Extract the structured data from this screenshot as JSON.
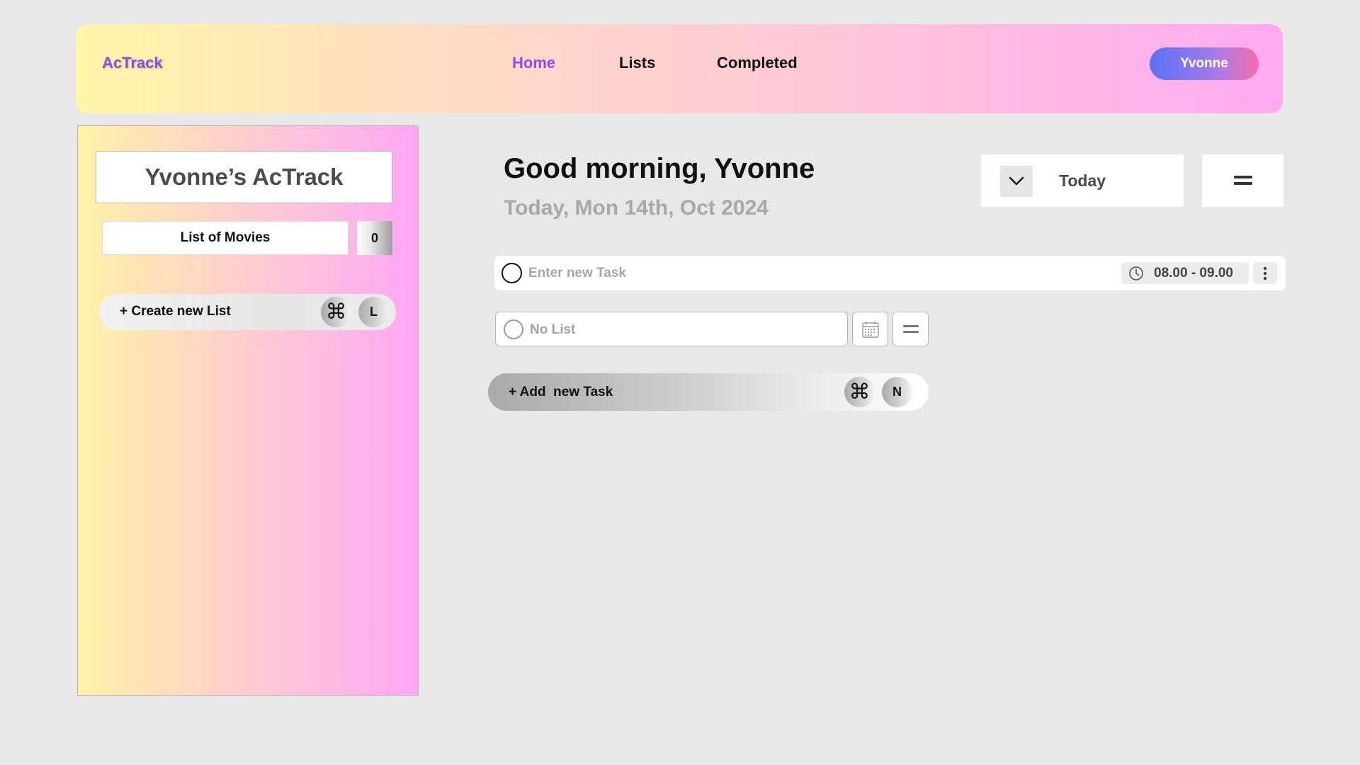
{
  "app": {
    "logo": "AcTrack"
  },
  "nav": {
    "items": [
      {
        "label": "Home",
        "active": true
      },
      {
        "label": "Lists",
        "active": false
      },
      {
        "label": "Completed",
        "active": false
      }
    ],
    "user": "Yvonne"
  },
  "sidebar": {
    "title": "Yvonne’s AcTrack",
    "lists": [
      {
        "name": "List of Movies",
        "count": "0"
      }
    ],
    "create_label": "+ Create new List",
    "create_shortcut": {
      "modifier": "⌘",
      "key": "L"
    }
  },
  "main": {
    "greeting": "Good morning, Yvonne",
    "date": "Today, Mon 14th, Oct 2024",
    "filter": {
      "label": "Today"
    },
    "task_entry": {
      "placeholder": "Enter new Task",
      "time": "08.00 - 09.00"
    },
    "list_select": {
      "label": "No List"
    },
    "add_task": {
      "label": "+ Add  new Task",
      "shortcut": {
        "modifier": "⌘",
        "key": "N"
      }
    }
  },
  "colors": {
    "accent": "#8a4cf0",
    "user_pill_start": "#5a72f6",
    "user_pill_end": "#f36fad",
    "header_gradient_start": "#fff6a8",
    "header_gradient_end": "#ffaaf3"
  },
  "icons": {
    "filter_toggle": "chevron-down-icon",
    "menu": "equals-icon",
    "time": "clock-icon",
    "more": "vertical-dots-icon",
    "calendar": "calendar-icon",
    "priority": "equals-icon",
    "shortcut_modifier": "command-key-icon"
  }
}
